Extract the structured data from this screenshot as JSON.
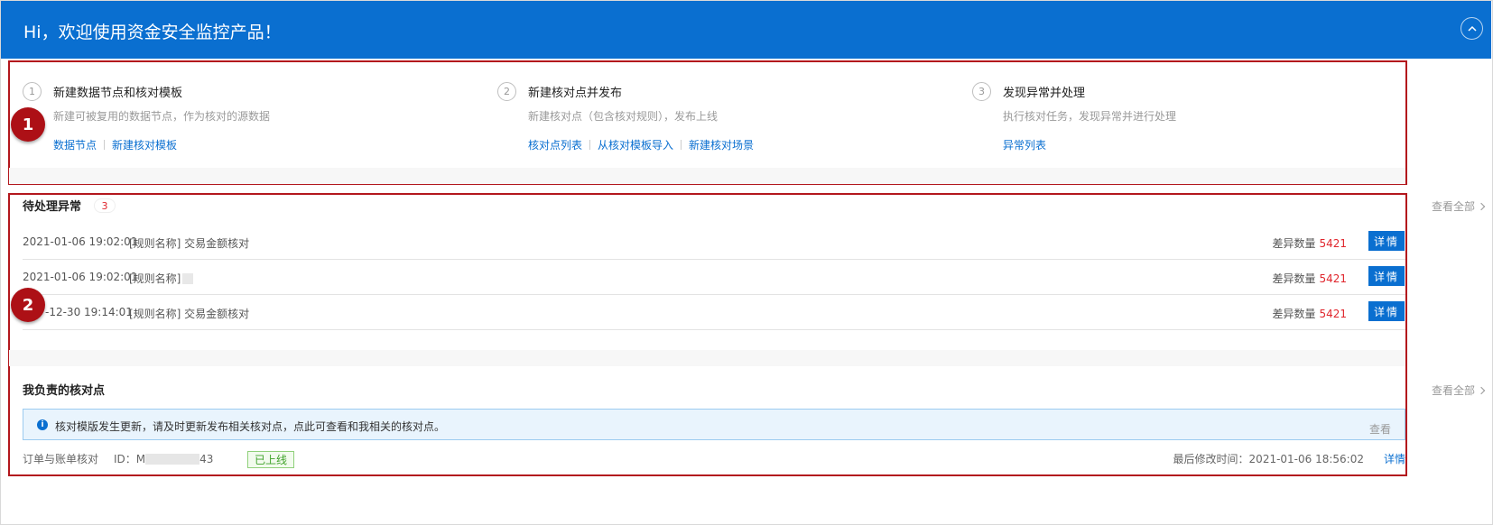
{
  "banner": {
    "title": "Hi，欢迎使用资金安全监控产品！"
  },
  "markers": [
    "1",
    "2"
  ],
  "steps": [
    {
      "num": "1",
      "title": "新建数据节点和核对模板",
      "desc": "新建可被复用的数据节点，作为核对的源数据",
      "links": [
        "数据节点",
        "新建核对模板"
      ]
    },
    {
      "num": "2",
      "title": "新建核对点并发布",
      "desc": "新建核对点（包含核对规则），发布上线",
      "links": [
        "核对点列表",
        "从核对模板导入",
        "新建核对场景"
      ]
    },
    {
      "num": "3",
      "title": "发现异常并处理",
      "desc": "执行核对任务，发现异常并进行处理",
      "links": [
        "异常列表"
      ]
    }
  ],
  "pending": {
    "title": "待处理异常",
    "count": "3",
    "view_all": "查看全部",
    "diff_label": "差异数量",
    "detail_label": "详情",
    "rows": [
      {
        "time": "2021-01-06 19:02:01",
        "rule": "[规则名称] 交易金额核对",
        "diff": "5421"
      },
      {
        "time": "2021-01-06 19:02:01",
        "rule": "[规则名称]",
        "diff": "5421"
      },
      {
        "time": "-12-30 19:14:01",
        "rule": "[规则名称] 交易金额核对",
        "diff": "5421"
      }
    ]
  },
  "mine": {
    "title": "我负责的核对点",
    "view_all": "查看全部",
    "notice": {
      "text": "核对模版发生更新，请及时更新发布相关核对点，点此可查看和我相关的核对点。",
      "action": "查看"
    },
    "item": {
      "name": "订单与账单核对",
      "id_prefix": "ID：M",
      "id_suffix": "43",
      "status": "已上线",
      "modified": "最后修改时间：2021-01-06 18:56:02",
      "detail": "详情"
    }
  },
  "colors": {
    "primary": "#0a6fd0",
    "danger": "#e0262d",
    "annotation": "#ad1016",
    "success": "#3fa22a"
  }
}
